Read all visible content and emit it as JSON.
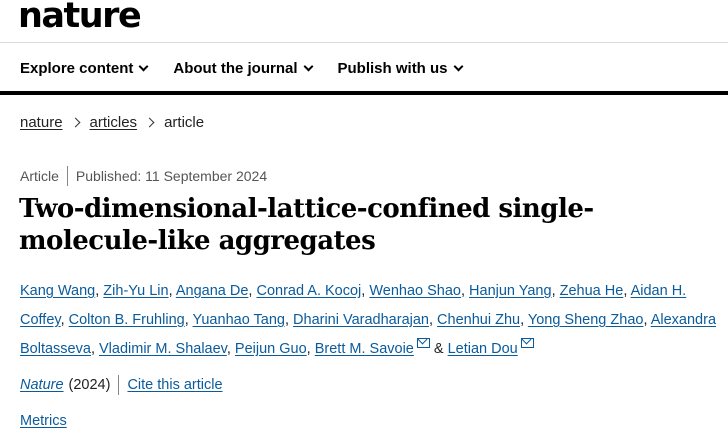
{
  "site": {
    "logo": "nature"
  },
  "nav": {
    "items": [
      {
        "label": "Explore content"
      },
      {
        "label": "About the journal"
      },
      {
        "label": "Publish with us"
      }
    ]
  },
  "breadcrumb": {
    "items": [
      "nature",
      "articles"
    ],
    "current": "article"
  },
  "article": {
    "type": "Article",
    "published": "Published: 11 September 2024",
    "title": "Two-dimensional-lattice-confined single-molecule-like aggregates",
    "authors": [
      "Kang Wang",
      "Zih-Yu Lin",
      "Angana De",
      "Conrad A. Kocoj",
      "Wenhao Shao",
      "Hanjun Yang",
      "Zehua He",
      "Aidan H. Coffey",
      "Colton B. Fruhling",
      "Yuanhao Tang",
      "Dharini Varadharajan",
      "Chenhui Zhu",
      "Yong Sheng Zhao",
      "Alexandra Boltasseva",
      "Vladimir M. Shalaev",
      "Peijun Guo",
      "Brett M. Savoie",
      "Letian Dou"
    ],
    "author_joiner": "&",
    "journal": "Nature",
    "year": "(2024)",
    "cite_label": "Cite this article",
    "metrics_label": "Metrics"
  },
  "icons": {
    "dropdown": "chevron-down-icon",
    "breadcrumb_sep": "chevron-right-icon",
    "email": "envelope-icon"
  },
  "colors": {
    "link": "#0a5b9c",
    "rule": "#000000",
    "text": "#222222"
  }
}
